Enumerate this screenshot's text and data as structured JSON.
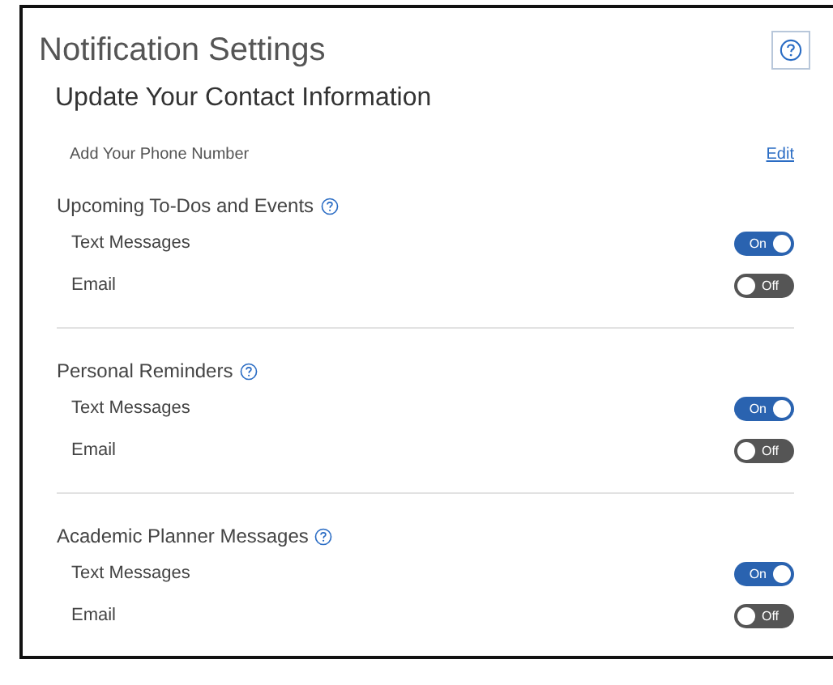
{
  "title": "Notification Settings",
  "contact": {
    "heading": "Update Your Contact Information",
    "label": "Add Your Phone Number",
    "link": "Edit"
  },
  "sections": [
    {
      "title": "Upcoming To-Dos and Events",
      "settings": [
        {
          "label": "Text Messages",
          "on": true,
          "state_label": "On"
        },
        {
          "label": "Email",
          "on": false,
          "state_label": "Off"
        }
      ]
    },
    {
      "title": "Personal Reminders",
      "settings": [
        {
          "label": "Text Messages",
          "on": true,
          "state_label": "On"
        },
        {
          "label": "Email",
          "on": false,
          "state_label": "Off"
        }
      ]
    },
    {
      "title": "Academic Planner Messages",
      "settings": [
        {
          "label": "Text Messages",
          "on": true,
          "state_label": "On"
        },
        {
          "label": "Email",
          "on": false,
          "state_label": "Off"
        }
      ]
    }
  ]
}
